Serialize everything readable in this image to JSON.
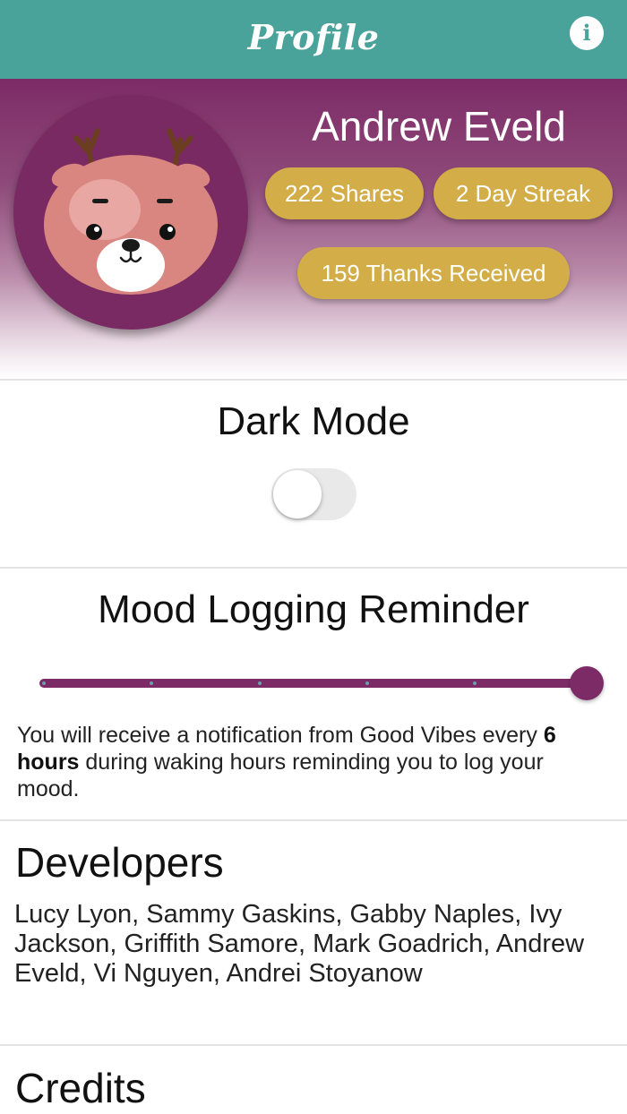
{
  "header": {
    "title": "Profile",
    "info_icon": "info-icon",
    "color": "#4aa39a"
  },
  "profile": {
    "avatar_icon": "deer-avatar",
    "name": "Andrew Eveld",
    "stats": {
      "shares": "222 Shares",
      "streak": "2 Day Streak",
      "thanks": "159 Thanks Received"
    },
    "pill_color": "#d2ad48",
    "gradient_top": "#7d2b66"
  },
  "dark_mode": {
    "title": "Dark Mode",
    "enabled": false
  },
  "reminder": {
    "title": "Mood Logging Reminder",
    "slider_value": 1.0,
    "slider_steps": 6,
    "text_before": "You will receive a notification from Good Vibes every ",
    "interval": "6 hours",
    "text_after": " during waking hours reminding you to log your mood.",
    "accent": "#7d2b66"
  },
  "developers": {
    "title": "Developers",
    "names": "Lucy Lyon, Sammy Gaskins, Gabby Naples, Ivy Jackson, Griffith Samore, Mark Goadrich, Andrew Eveld, Vi Nguyen, Andrei Stoyanow"
  },
  "credits": {
    "title": "Credits"
  }
}
